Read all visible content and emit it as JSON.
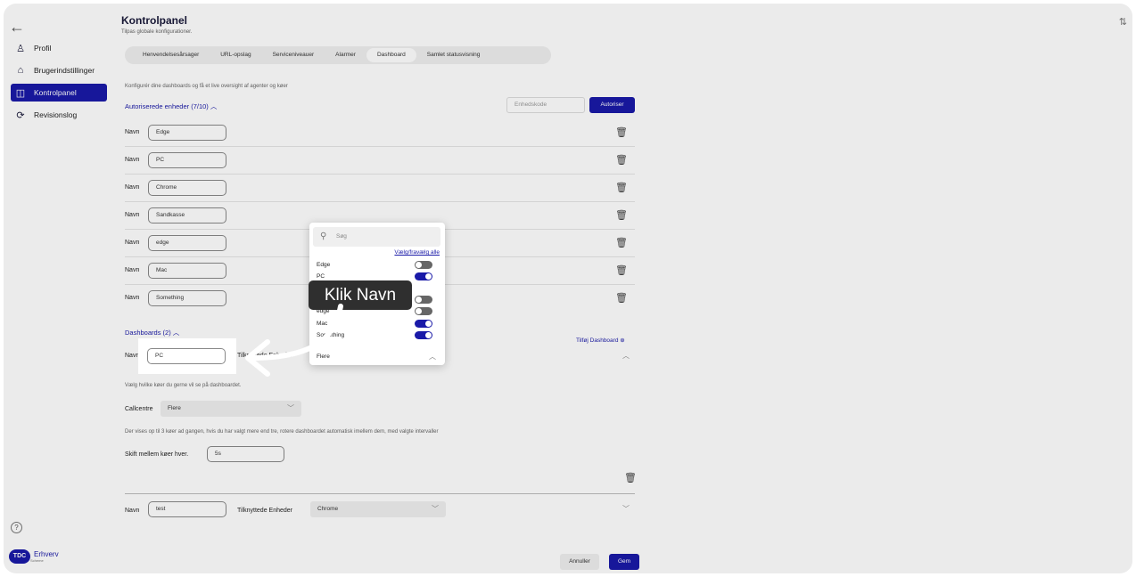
{
  "nav": {
    "back": "←",
    "corner": "⇅"
  },
  "sidebar": {
    "items": [
      {
        "label": "Profil",
        "icon": "♙"
      },
      {
        "label": "Brugerindstillinger",
        "icon": "⌂"
      },
      {
        "label": "Kontrolpanel",
        "icon": "◫"
      },
      {
        "label": "Revisionslog",
        "icon": "⟳"
      }
    ],
    "help": "?",
    "logo_badge": "TDC",
    "logo_text": "Erhverv",
    "logo_sub": "Scheme"
  },
  "main": {
    "title": "Kontrolpanel",
    "subtitle": "Tilpas globale konfigurationer.",
    "tabs": [
      "Henvendelsesårsager",
      "URL-opslag",
      "Serviceniveauer",
      "Alarmer",
      "Dashboard",
      "Samlet statusvisning"
    ],
    "description": "Konfigurér dine dashboards og få et live oversight af agenter og køer",
    "units_header": "Autoriserede enheder (7/10) ︿",
    "unit_code_placeholder": "Enhedskode",
    "authorize_label": "Autoriser",
    "name_label": "Navn",
    "trash": "🗑",
    "units": [
      "Edge",
      "PC",
      "Chrome",
      "Sandkasse",
      "edge",
      "Mac",
      "Something"
    ],
    "dashboards_header": "Dashboards (2) ︿",
    "add_dashboard": "Tilføj Dashboard ⊕",
    "dashboard1": {
      "name": "PC",
      "devices_label": "Tilknyttede Enheder",
      "queue_note": "Vælg hvilke køer du gerne vil se på dashboardet.",
      "callcentre_label": "Callcentre",
      "callcentre_value": "Flere",
      "rotate_note": "Der vises op til 3 køer ad gangen, hvis du har valgt mere end tre, rotere dashboardet automatisk imellem dem, med valgte intervaller",
      "switch_label": "Skift mellem køer hver.",
      "switch_value": "5s"
    },
    "dashboard2": {
      "name": "test",
      "devices_label": "Tilknyttede Enheder",
      "devices_value": "Chrome"
    },
    "cancel_label": "Annuller",
    "save_label": "Gem"
  },
  "popup": {
    "search_placeholder": "Søg",
    "select_all": "Vælg/fravælg alle",
    "items": [
      {
        "label": "Edge",
        "on": false
      },
      {
        "label": "PC",
        "on": true
      },
      {
        "label": "",
        "on": false
      },
      {
        "label": "edge",
        "on": false
      },
      {
        "label": "Mac",
        "on": true
      },
      {
        "label": "Something",
        "on": true
      }
    ],
    "value": "Flere"
  },
  "tooltip": "Klik Navn"
}
